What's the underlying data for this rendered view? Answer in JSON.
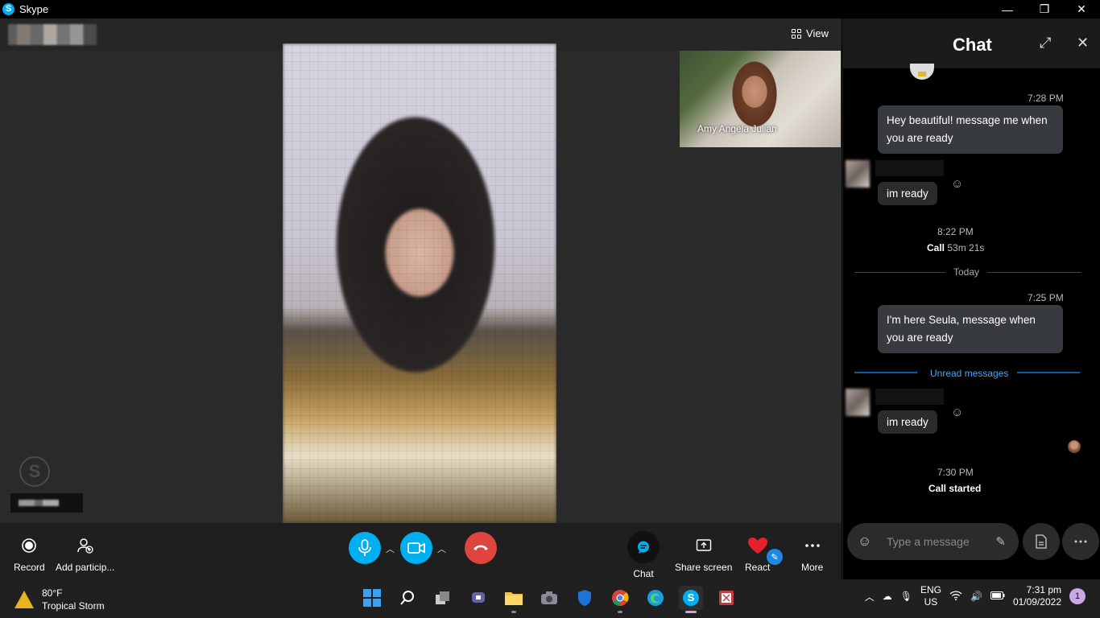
{
  "window": {
    "title": "Skype",
    "logo_letter": "S"
  },
  "window_controls": {
    "minimize": "—",
    "restore": "❐",
    "close": "✕"
  },
  "stage": {
    "view_label": "View"
  },
  "self_view": {
    "name": "Amy Angela Julian"
  },
  "callbar": {
    "record": "Record",
    "add_participants": "Add particip...",
    "chat": "Chat",
    "share_screen": "Share screen",
    "react": "React",
    "more": "More"
  },
  "chat": {
    "title": "Chat",
    "messages": {
      "t1": "7:28 PM",
      "m1": "Hey beautiful! message me when you are ready",
      "r1": "im ready",
      "t2": "8:22 PM",
      "call_label": "Call",
      "call_duration": "53m 21s",
      "today": "Today",
      "t3": "7:25 PM",
      "m2": "I'm here Seula, message when you are ready",
      "unread": "Unread messages",
      "r2": "im ready",
      "t4": "7:30 PM",
      "call_started": "Call started"
    },
    "composer_placeholder": "Type a message"
  },
  "taskbar": {
    "weather_temp": "80°F",
    "weather_desc": "Tropical Storm",
    "lang_top": "ENG",
    "lang_bottom": "US",
    "time": "7:31 pm",
    "date": "01/09/2022",
    "notification_count": "1"
  },
  "colors": {
    "accent": "#00aff0",
    "hangup": "#e0443e",
    "unread": "#4ea3f0"
  }
}
